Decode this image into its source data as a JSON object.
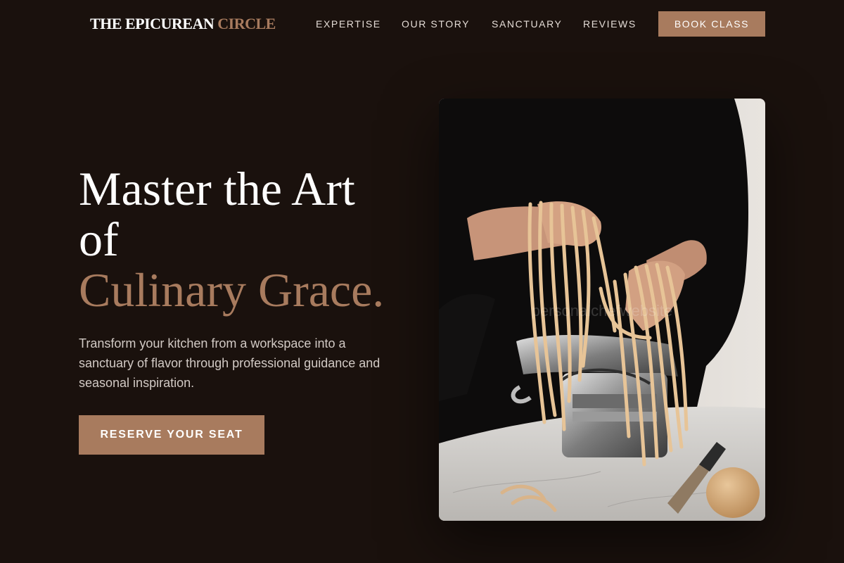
{
  "header": {
    "logo_main": "THE EPICUREAN",
    "logo_accent": "CIRCLE",
    "nav": [
      {
        "label": "EXPERTISE"
      },
      {
        "label": "OUR STORY"
      },
      {
        "label": "SANCTUARY"
      },
      {
        "label": "REVIEWS"
      }
    ],
    "cta_label": "BOOK CLASS"
  },
  "hero": {
    "headline_line1": "Master the Art",
    "headline_line2": "of",
    "headline_accent": "Culinary Grace.",
    "subtext": "Transform your kitchen from a workspace into a sanctuary of flavor through professional guidance and seasonal inspiration.",
    "cta_label": "RESERVE YOUR SEAT",
    "image_watermark": "personalchefwebsite"
  },
  "colors": {
    "background": "#1a110d",
    "accent": "#a87b5e",
    "text": "#ffffff",
    "muted_text": "#d2cac5"
  }
}
